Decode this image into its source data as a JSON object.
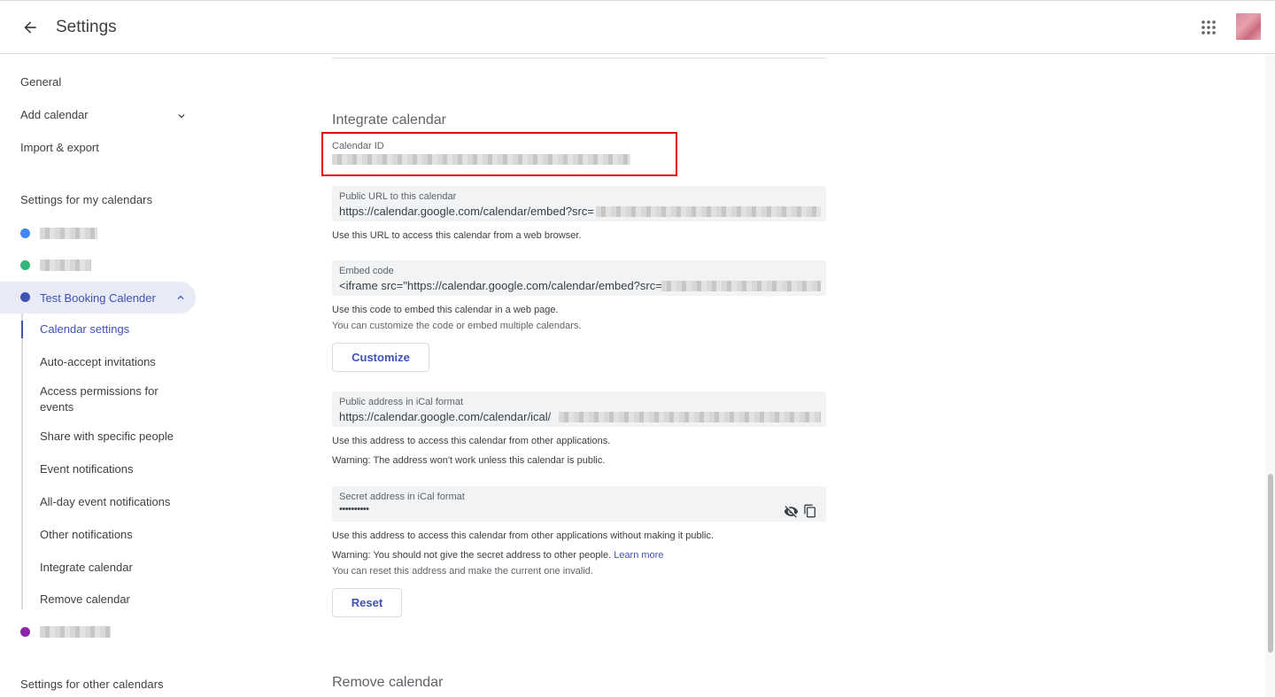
{
  "header": {
    "back_icon": "arrow-back-icon",
    "title": "Settings",
    "apps_icon": "apps-grid-icon"
  },
  "sidebar": {
    "general": "General",
    "add_calendar": "Add calendar",
    "import_export": "Import & export",
    "my_calendars_heading": "Settings for my calendars",
    "calendars": [
      {
        "color": "#4285f4"
      },
      {
        "color": "#33b679"
      },
      {
        "label": "Test Booking Calender",
        "color": "#3f51b5"
      },
      {
        "color": "#8e24aa"
      }
    ],
    "sub_items": [
      "Calendar settings",
      "Auto-accept invitations",
      "Access permissions for events",
      "Share with specific people",
      "Event notifications",
      "All-day event notifications",
      "Other notifications",
      "Integrate calendar",
      "Remove calendar"
    ],
    "other_calendars_heading": "Settings for other calendars"
  },
  "main": {
    "integrate_title": "Integrate calendar",
    "calendar_id_label": "Calendar ID",
    "public_url": {
      "label": "Public URL to this calendar",
      "value": "https://calendar.google.com/calendar/embed?src=",
      "help": "Use this URL to access this calendar from a web browser."
    },
    "embed_code": {
      "label": "Embed code",
      "value": "<iframe src=\"https://calendar.google.com/calendar/embed?src=",
      "help1": "Use this code to embed this calendar in a web page.",
      "help2": "You can customize the code or embed multiple calendars."
    },
    "customize_button": "Customize",
    "ical_public": {
      "label": "Public address in iCal format",
      "value": "https://calendar.google.com/calendar/ical/",
      "help1": "Use this address to access this calendar from other applications.",
      "help2": "Warning: The address won't work unless this calendar is public."
    },
    "ical_secret": {
      "label": "Secret address in iCal format",
      "value": "••••••••••",
      "help1": "Use this address to access this calendar from other applications without making it public.",
      "help2": "Warning: You should not give the secret address to other people.",
      "learn_more": "Learn more",
      "help3": "You can reset this address and make the current one invalid.",
      "show_icon": "visibility-off-icon",
      "copy_icon": "copy-icon"
    },
    "reset_button": "Reset",
    "remove_title": "Remove calendar"
  },
  "colors": {
    "accent": "#3f51b5",
    "highlight_box": "#e8000b"
  }
}
